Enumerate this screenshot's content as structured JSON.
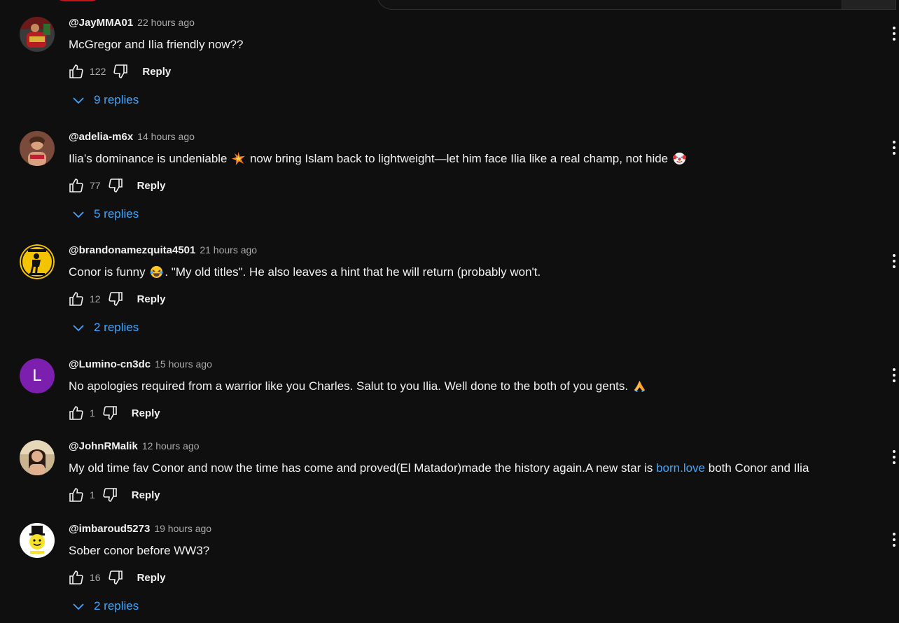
{
  "comments": [
    {
      "author": "@JayMMA01",
      "time": "22 hours ago",
      "text_parts": [
        "McGregor and Ilia friendly now??"
      ],
      "likes": "122",
      "reply_label": "Reply",
      "replies_label": "9 replies",
      "avatar_icon": "fighter-avatar-icon"
    },
    {
      "author": "@adelia-m6x",
      "time": "14 hours ago",
      "text_parts": [
        "Ilia’s dominance is undeniable ",
        " now bring Islam back to lightweight—let him face Ilia like a real champ, not hide "
      ],
      "emojis": [
        "collision-emoji",
        "clown-emoji"
      ],
      "likes": "77",
      "reply_label": "Reply",
      "replies_label": "5 replies",
      "avatar_icon": "person-avatar-icon"
    },
    {
      "author": "@brandonamezquita4501",
      "time": "21 hours ago",
      "text_parts": [
        "Conor is funny ",
        ". \"My old titles\". He also leaves a hint that he will return (probably won't."
      ],
      "emojis": [
        "laughing-emoji"
      ],
      "likes": "12",
      "reply_label": "Reply",
      "replies_label": "2 replies",
      "avatar_icon": "bigfoot-sign-avatar-icon"
    },
    {
      "author": "@Lumino-cn3dc",
      "time": "15 hours ago",
      "text_parts": [
        "No apologies required from a warrior like you Charles. Salut to you Ilia. Well done to the both of you gents. "
      ],
      "emojis": [
        "folded-hands-emoji"
      ],
      "likes": "1",
      "reply_label": "Reply",
      "avatar_letter": "L",
      "avatar_color": "#7d1fae"
    },
    {
      "author": "@JohnRMalik",
      "time": "12 hours ago",
      "text_before_link": "My old time fav Conor and now the time has come and proved(El Matador)made the history again.A new star is ",
      "link": "born.love",
      "text_after_link": " both Conor and Ilia",
      "likes": "1",
      "reply_label": "Reply",
      "avatar_icon": "person-avatar-icon"
    },
    {
      "author": "@imbaroud5273",
      "time": "19 hours ago",
      "text_parts": [
        "Sober conor before WW3?"
      ],
      "likes": "16",
      "reply_label": "Reply",
      "replies_label": "2 replies",
      "avatar_icon": "smiley-avatar-icon"
    }
  ],
  "colors": {
    "background": "#0f0f0f",
    "text": "#f1f1f1",
    "secondary_text": "#aaaaaa",
    "accent_blue": "#3ea6ff"
  }
}
